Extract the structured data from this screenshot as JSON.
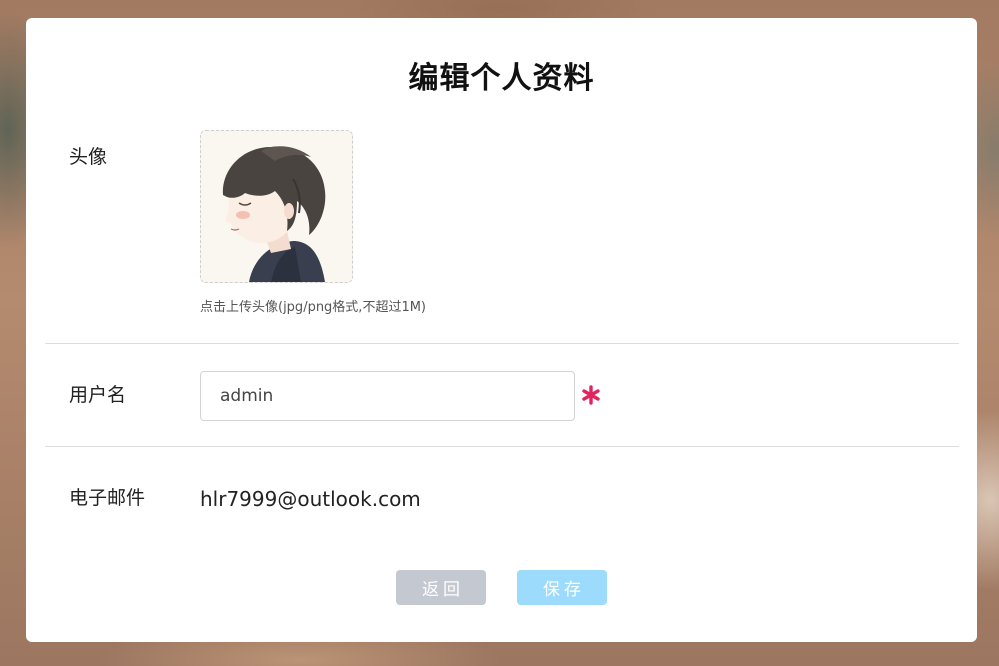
{
  "page": {
    "title": "编辑个人资料"
  },
  "avatar": {
    "label": "头像",
    "upload_hint": "点击上传头像(jpg/png格式,不超过1M)",
    "icon": "avatar-image"
  },
  "username": {
    "label": "用户名",
    "value": "admin",
    "required_icon": "asterisk-icon",
    "required_color": "#e0245e"
  },
  "email": {
    "label": "电子邮件",
    "value": "hlr7999@outlook.com"
  },
  "actions": {
    "back_label": "返回",
    "save_label": "保存"
  },
  "colors": {
    "back_button": "#c4c8d1",
    "save_button": "#9cdbfb"
  }
}
